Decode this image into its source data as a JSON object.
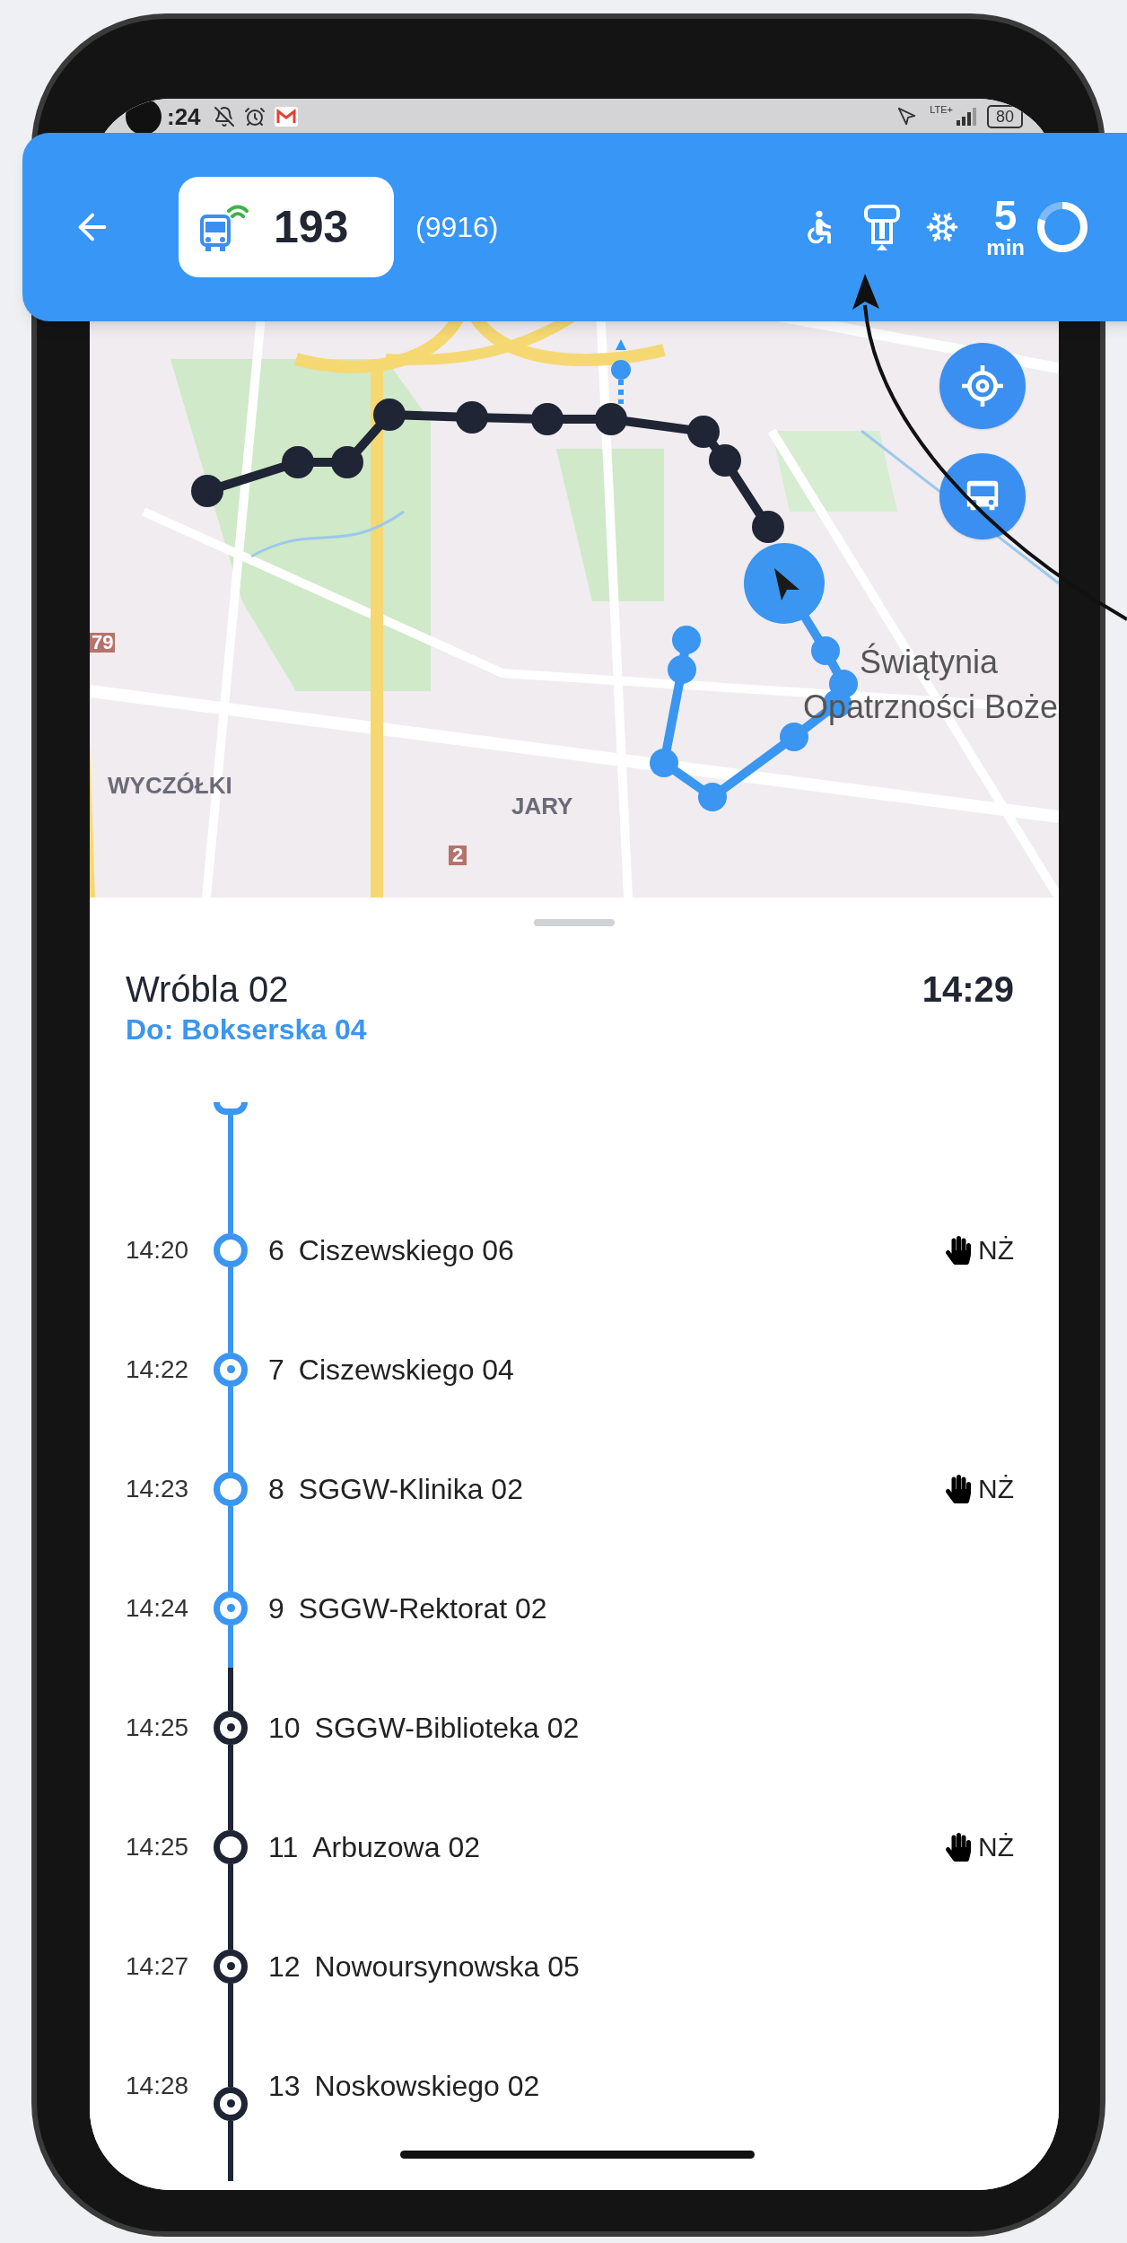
{
  "status_bar": {
    "time": ":24",
    "network": "LTE+",
    "battery": "80"
  },
  "header": {
    "line": "193",
    "vehicle": "(9916)",
    "eta_value": "5",
    "eta_unit": "min",
    "refresh_timer": {
      "level": 0.8
    }
  },
  "map": {
    "labels": [
      "WYCZÓŁKI",
      "JARY",
      "Świątynia",
      "Opatrzności Boże",
      "79",
      "2"
    ]
  },
  "sheet": {
    "stop_name": "Wróbla 02",
    "direction": "Do: Bokserska 04",
    "time": "14:29"
  },
  "stops": [
    {
      "time": "14:20",
      "number": "6",
      "name": "Ciszewskiego 06",
      "passed": true,
      "on_request": true,
      "badge": "NŻ"
    },
    {
      "time": "14:22",
      "number": "7",
      "name": "Ciszewskiego 04",
      "passed": true,
      "on_request": false
    },
    {
      "time": "14:23",
      "number": "8",
      "name": "SGGW-Klinika 02",
      "passed": true,
      "on_request": true,
      "badge": "NŻ"
    },
    {
      "time": "14:24",
      "number": "9",
      "name": "SGGW-Rektorat 02",
      "passed": true,
      "on_request": false
    },
    {
      "time": "14:25",
      "number": "10",
      "name": "SGGW-Biblioteka 02",
      "passed": false,
      "on_request": false
    },
    {
      "time": "14:25",
      "number": "11",
      "name": "Arbuzowa 02",
      "passed": false,
      "on_request": true,
      "badge": "NŻ"
    },
    {
      "time": "14:27",
      "number": "12",
      "name": "Nowoursynowska 05",
      "passed": false,
      "on_request": false
    },
    {
      "time": "14:28",
      "number": "13",
      "name": "Noskowskiego 02",
      "passed": false,
      "on_request": false
    }
  ]
}
